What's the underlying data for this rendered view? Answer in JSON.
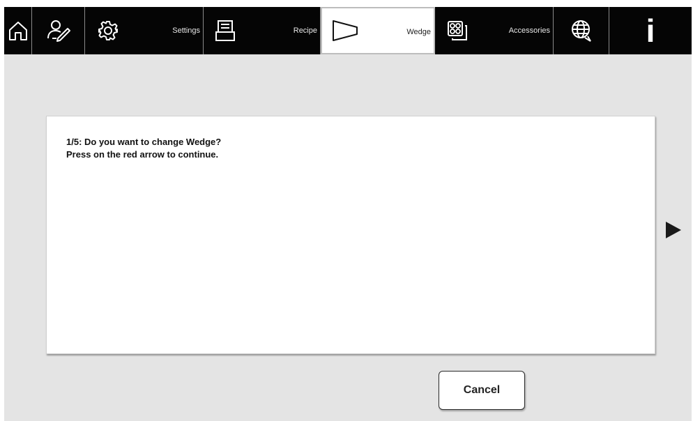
{
  "topbar": {
    "items": [
      {
        "icon": "home-icon",
        "label": ""
      },
      {
        "icon": "user-edit-icon",
        "label": ""
      },
      {
        "icon": "gear-icon",
        "label": "Settings"
      },
      {
        "icon": "recipe-icon",
        "label": "Recipe"
      },
      {
        "icon": "wedge-icon",
        "label": "Wedge",
        "active": true
      },
      {
        "icon": "accessories-icon",
        "label": "Accessories"
      },
      {
        "icon": "globe-icon",
        "label": ""
      },
      {
        "icon": "info-icon",
        "label": "i"
      }
    ]
  },
  "dialog": {
    "line1": "1/5: Do you want to change Wedge?",
    "line2": "Press on the red arrow to continue."
  },
  "next_arrow": {
    "icon": "play-arrow-icon"
  },
  "cancel": {
    "label": "Cancel"
  }
}
